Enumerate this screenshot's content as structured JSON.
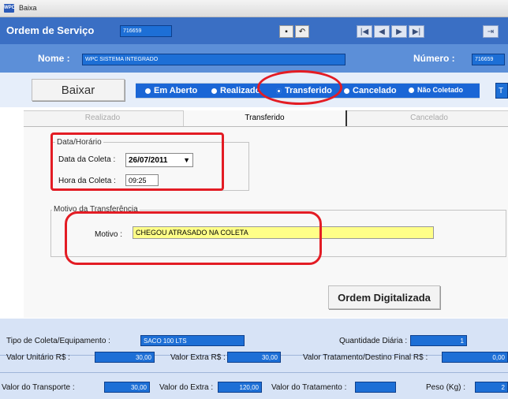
{
  "window": {
    "title": "Baixa",
    "app_icon": "app-icon"
  },
  "header": {
    "ordem_label": "Ordem de Serviço",
    "ordem_value": "716659",
    "nav_buttons": [
      "|◀",
      "◀",
      "▶",
      "▶|"
    ]
  },
  "cliente": {
    "nome_label": "Nome :",
    "nome_value": "WPC SISTEMA INTEGRADO",
    "numero_label": "Número :",
    "numero_value": "716659"
  },
  "status": {
    "baixar_label": "Baixar",
    "options": [
      "Em Aberto",
      "Realizado",
      "Transferido",
      "Cancelado",
      "Não Coletado"
    ],
    "selected": "Transferido",
    "extra_label": "T"
  },
  "tabs": [
    "Realizado",
    "Transferido",
    "Cancelado"
  ],
  "active_tab": "Transferido",
  "data_horario": {
    "group_label": "Data/Horário",
    "data_label": "Data da Coleta :",
    "data_value": "26/07/2011",
    "hora_label": "Hora da Coleta :",
    "hora_value": "09:25"
  },
  "motivo": {
    "group_label": "Motivo da Transferência",
    "label": "Motivo :",
    "value": "CHEGOU ATRASADO NA COLETA"
  },
  "ordem_digitalizada": "Ordem Digitalizada",
  "bottom": {
    "tipo_label": "Tipo de Coleta/Equipamento :",
    "tipo_value": "SACO 100 LTS",
    "qtd_label": "Quantidade Diária :",
    "qtd_value": "1",
    "valor_unit_label": "Valor Unitário R$ :",
    "valor_unit_value": "30,00",
    "valor_extra_label": "Valor Extra R$ :",
    "valor_extra_value": "30,00",
    "valor_trat_label": "Valor Tratamento/Destino Final R$ :",
    "valor_trat_value": "0,00",
    "transp_label": "Valor do Transporte :",
    "transp_value": "30,00",
    "do_extra_label": "Valor do Extra :",
    "do_extra_value": "120,00",
    "tratamento_label": "Valor do Tratamento :",
    "tratamento_value": "",
    "peso_label": "Peso (Kg) :",
    "peso_value": "2"
  },
  "colors": {
    "accent": "#1d6fd6",
    "header": "#3a6fc4",
    "annotation": "#e31c24",
    "motivo_bg": "#ffff88"
  }
}
